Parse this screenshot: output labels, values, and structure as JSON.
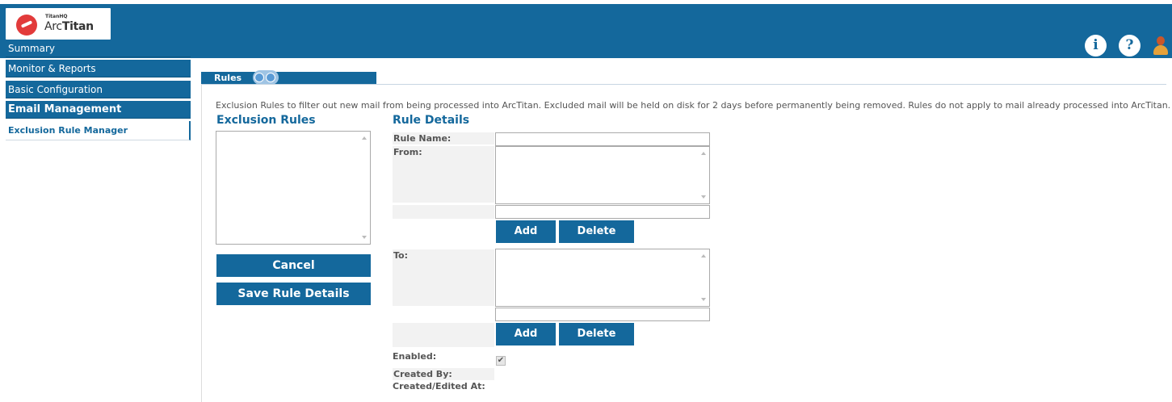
{
  "header": {
    "logo_small": "TitanHQ",
    "logo_text_light": "Arc",
    "logo_text_bold": "Titan",
    "info_glyph": "i",
    "help_glyph": "?",
    "icons": [
      "info-icon",
      "help-icon",
      "user-icon"
    ]
  },
  "sidebar": {
    "items": [
      {
        "label": "Summary"
      },
      {
        "label": "Monitor & Reports"
      },
      {
        "label": "Basic Configuration"
      },
      {
        "label": "Email Management"
      }
    ],
    "sub_item": "Exclusion Rule Manager"
  },
  "tab": {
    "label": "Rules"
  },
  "description": "Exclusion Rules to filter out new mail from being processed into ArcTitan. Excluded mail will be held on disk for 2 days before permanently being removed. Rules do not apply to mail already processed into ArcTitan.",
  "exclusion_rules": {
    "title": "Exclusion Rules",
    "cancel_label": "Cancel",
    "save_label": "Save Rule Details"
  },
  "rule_details": {
    "title": "Rule Details",
    "rule_name_label": "Rule Name:",
    "from_label": "From:",
    "to_label": "To:",
    "add_label": "Add",
    "delete_label": "Delete",
    "enabled_label": "Enabled:",
    "enabled_checked": true,
    "check_glyph": "✔",
    "created_by_label": "Created By:",
    "created_edited_label": "Created/Edited At:"
  },
  "colors": {
    "brand": "#14689c"
  }
}
